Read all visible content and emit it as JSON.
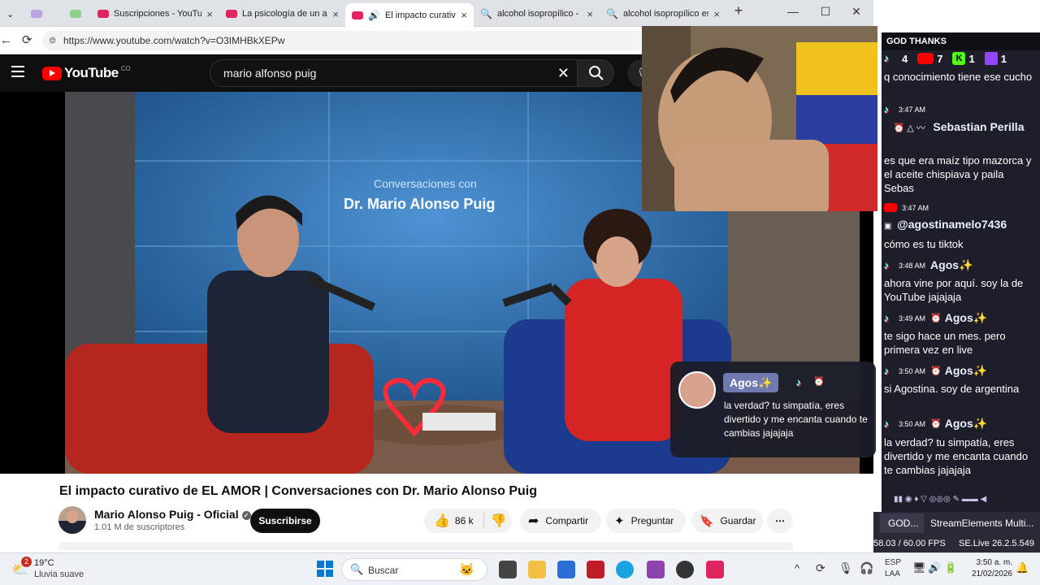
{
  "browser": {
    "tabs": [
      {
        "title": "",
        "favicon": "#b9a3e0"
      },
      {
        "title": "",
        "favicon": "#8fd08a"
      },
      {
        "title": "Suscripciones - YouTube",
        "favicon": "#e0245e"
      },
      {
        "title": "La psicología de un adic",
        "favicon": "#e0245e"
      },
      {
        "title": "El impacto curativo",
        "favicon": "#e0245e"
      },
      {
        "title": "alcohol isopropílico - Bú",
        "favicon": "#1a73e8"
      },
      {
        "title": "alcohol isopropílico es ig",
        "favicon": "#1a73e8"
      }
    ],
    "url": "https://www.youtube.com/watch?v=O3IMHBkXEPw"
  },
  "youtube": {
    "logo": "YouTube",
    "country": "CO",
    "search_value": "mario alfonso puig",
    "video": {
      "banner_small": "Conversaciones con",
      "banner_big": "Dr. Mario Alonso Puig"
    },
    "title": "El impacto curativo de EL AMOR | Conversaciones con Dr. Mario Alonso Puig",
    "channel": "Mario Alonso Puig - Oficial",
    "subscribers": "1.01 M de suscriptores",
    "subscribe_label": "Suscribirse",
    "likes": "86 k",
    "share_label": "Compartir",
    "ask_label": "Preguntar",
    "save_label": "Guardar"
  },
  "chat": {
    "header": "GOD THANKS",
    "counts": {
      "tiktok": "4",
      "youtube": "7",
      "kick": "1",
      "twitch": "1"
    },
    "top_text": "q conocimiento tiene ese cucho",
    "messages": [
      {
        "time": "3:47 AM",
        "user": "Sebastian Perilla",
        "text": "es que era maíz tipo mazorca y el aceite chispiava y paila Sebas"
      },
      {
        "time": "3:47 AM",
        "user": "@agostinamelo7436",
        "text": "cómo es tu tiktok"
      },
      {
        "time": "3:48 AM",
        "user": "Agos✨",
        "text": "ahora vine por aquí. soy la de YouTube jajajaja"
      },
      {
        "time": "3:49 AM",
        "user": "Agos✨",
        "text": "te sigo hace un mes. pero primera vez en live"
      },
      {
        "time": "3:50 AM",
        "user": "Agos✨",
        "text": "si Agostina. soy de argentina"
      },
      {
        "time": "3:50 AM",
        "user": "Agos✨",
        "text": "la verdad? tu simpatía, eres divertido y me encanta cuando te cambias jajajaja"
      }
    ]
  },
  "notification": {
    "user": "Agos✨",
    "text": "la verdad? tu simpatía, eres divertido y me encanta cuando te cambias jajajaja"
  },
  "obs": {
    "dock1": "GOD...",
    "dock2": "StreamElements Multi...",
    "fps": "58.03 / 60.00 FPS",
    "version": "SE.Live 26.2.5.549"
  },
  "taskbar": {
    "temp": "19°C",
    "weather": "Lluvia suave",
    "badge": "2",
    "search_placeholder": "Buscar",
    "lang1": "ESP",
    "lang2": "LAA",
    "time": "3:50 a. m.",
    "date": "21/02/2026"
  }
}
